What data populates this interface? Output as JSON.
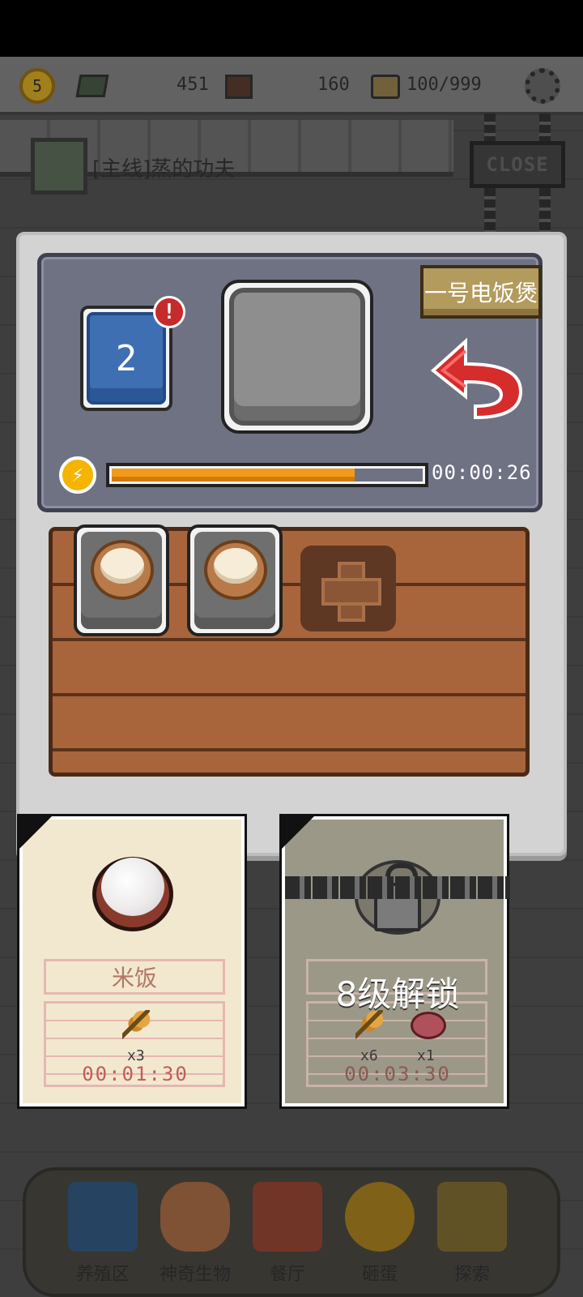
{
  "topbar": {
    "level": "5",
    "cash_value": "451",
    "gems_value": "160",
    "seed_capacity": "100/999"
  },
  "quest": {
    "text": "[主线]蒸的功夫"
  },
  "close_sign": "CLOSE",
  "stove": {
    "label": "一号电饭煲",
    "queue_count": "2",
    "alert": "!",
    "progress_fraction": 0.78,
    "timer": "00:00:26",
    "energy_icon": "lightning-icon",
    "back_icon": "red-curved-arrow-icon"
  },
  "tray": {
    "items": [
      "bun-basket-icon",
      "bun-basket-icon"
    ],
    "add_icon": "plus-icon"
  },
  "recipes": [
    {
      "name": "米饭",
      "icon": "rice-bowl-icon",
      "ingredients": [
        {
          "icon": "wheat-icon",
          "qty": "x3"
        }
      ],
      "time": "00:01:30",
      "locked": false
    },
    {
      "lock_text": "8级解锁",
      "icon": "locked-pot-icon",
      "ingredients": [
        {
          "icon": "wheat-icon",
          "qty": "x6"
        },
        {
          "icon": "meat-icon",
          "qty": "x1"
        }
      ],
      "time": "00:03:30",
      "locked": true
    }
  ],
  "bottom_nav": [
    {
      "label": "养殖区",
      "icon": "farm-house-icon"
    },
    {
      "label": "神奇生物",
      "icon": "pig-icon"
    },
    {
      "label": "餐厅",
      "icon": "restaurant-icon"
    },
    {
      "label": "砸蛋",
      "icon": "egg-icon"
    },
    {
      "label": "探索",
      "icon": "map-icon"
    }
  ],
  "colors": {
    "progress": "#f39a1a",
    "alert": "#c62a2a",
    "level_button": "#3f6fb3",
    "tray_wood": "#9a5a34"
  }
}
